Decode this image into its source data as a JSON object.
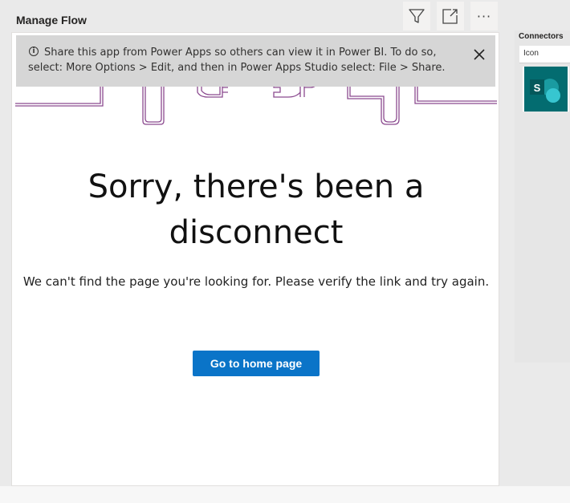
{
  "header": {
    "title": "Manage Flow"
  },
  "toolbar": {
    "more_label": "···"
  },
  "banner": {
    "info_glyph": "i",
    "text": "Share this app from Power Apps so others can view it in Power BI. To do so, select: More Options > Edit, and then in Power Apps Studio select: File > Share."
  },
  "error": {
    "heading": "Sorry, there's been a disconnect",
    "message": "We can't find the page you're looking for. Please verify the link and try again.",
    "button_label": "Go to home page"
  },
  "side_panel": {
    "label": "Connectors",
    "column_header": "Icon",
    "tile_letter": "S",
    "tile_icon": "sharepoint-icon"
  },
  "colors": {
    "accent": "#0a74c8",
    "banner_bg": "#d6d6d6",
    "sharepoint": "#036c70",
    "illustration": "#8b4a8f"
  }
}
